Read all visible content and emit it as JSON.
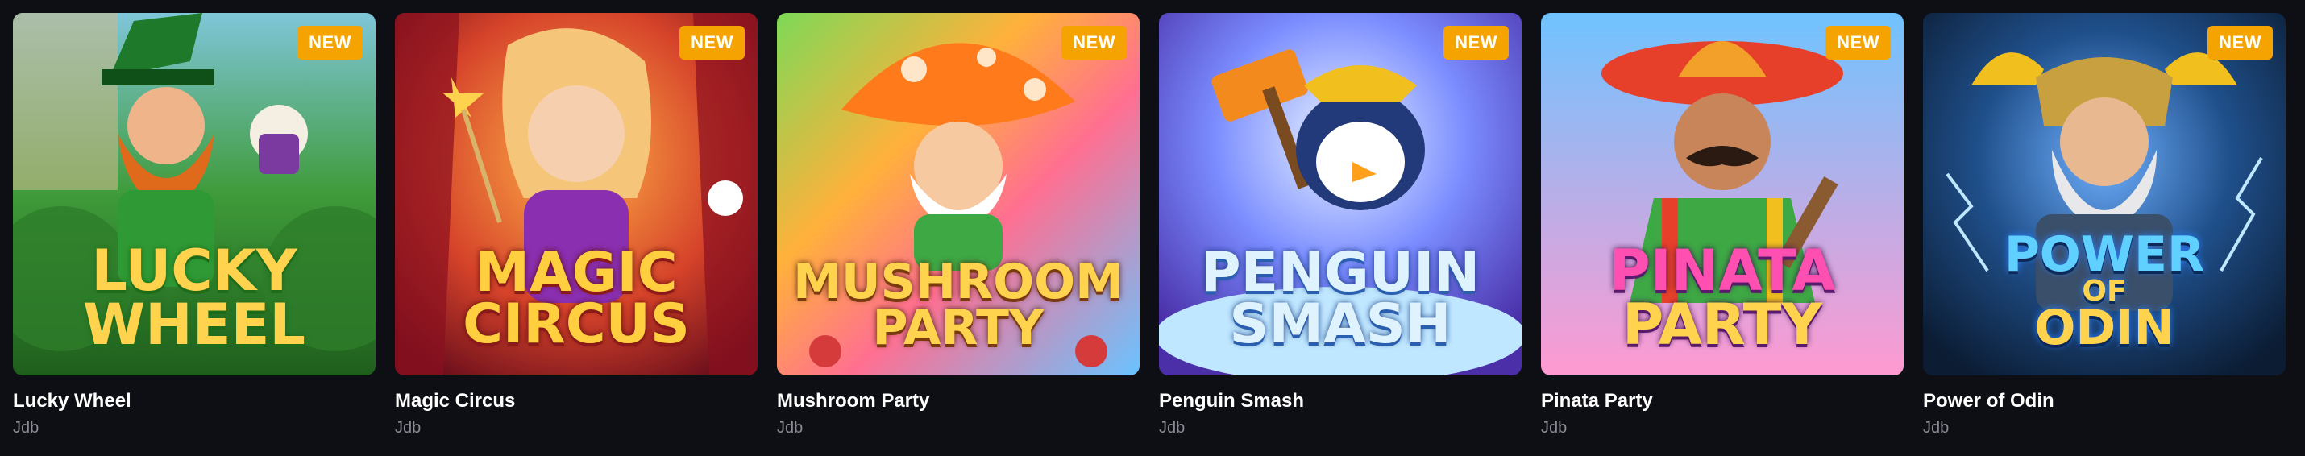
{
  "badge_label": "NEW",
  "games": [
    {
      "title": "Lucky Wheel",
      "provider": "Jdb",
      "logo_lines": [
        "LUCKY",
        "WHEEL"
      ],
      "theme": "leprechaun"
    },
    {
      "title": "Magic Circus",
      "provider": "Jdb",
      "logo_lines": [
        "MAGIC",
        "CIRCUS"
      ],
      "theme": "magician"
    },
    {
      "title": "Mushroom Party",
      "provider": "Jdb",
      "logo_lines": [
        "MUSHROOM",
        "PARTY"
      ],
      "theme": "mushroom"
    },
    {
      "title": "Penguin Smash",
      "provider": "Jdb",
      "logo_lines": [
        "PENGUIN",
        "SMASH"
      ],
      "theme": "penguin"
    },
    {
      "title": "Pinata Party",
      "provider": "Jdb",
      "logo_lines": [
        "PINATA",
        "PARTY"
      ],
      "theme": "mariachi"
    },
    {
      "title": "Power of Odin",
      "provider": "Jdb",
      "logo_lines": [
        "POWER",
        "OF",
        "ODIN"
      ],
      "theme": "viking"
    }
  ],
  "colors": {
    "background": "#0e0f14",
    "badge": "#f5a300",
    "title": "#ffffff",
    "provider": "#8a8c95"
  }
}
